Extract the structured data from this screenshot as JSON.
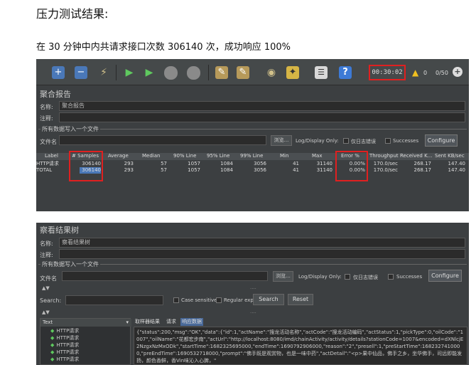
{
  "doc": {
    "title": "压力测试结果:",
    "summary": "在 30 分钟中内共请求接口次数 306140 次，成功响应 100%"
  },
  "aggregate": {
    "timer": "00:30:02",
    "warn_count": "0",
    "threads": "0/50",
    "panel_title": "聚合报告",
    "name_label": "名称:",
    "name_value": "聚合报告",
    "comment_label": "注释:",
    "group_title": "所有数据写入一个文件",
    "file_label": "文件名",
    "browse_label": "浏览...",
    "log_display": "Log/Display Only:",
    "errors_only": "仅日志错误",
    "successes": "Successes",
    "configure": "Configure",
    "columns": [
      "Label",
      "# Samples",
      "Average",
      "Median",
      "90% Line",
      "95% Line",
      "99% Line",
      "Min",
      "Max",
      "Error %",
      "Throughput",
      "Received K...",
      "Sent KB/sec"
    ],
    "rows": [
      [
        "HTTP请求",
        "306140",
        "293",
        "57",
        "1057",
        "1084",
        "3056",
        "41",
        "31140",
        "0.00%",
        "170.0/sec",
        "268.17",
        "147.40"
      ],
      [
        "TOTAL",
        "306140",
        "293",
        "57",
        "1057",
        "1084",
        "3056",
        "41",
        "31140",
        "0.00%",
        "170.0/sec",
        "268.17",
        "147.40"
      ]
    ]
  },
  "results_tree": {
    "panel_title": "察看结果树",
    "name_label": "名称:",
    "name_value": "察看结果树",
    "comment_label": "注释:",
    "group_title": "所有数据写入一个文件",
    "file_label": "文件名",
    "browse_label": "浏览...",
    "log_display": "Log/Display Only:",
    "errors_only": "仅日志错误",
    "successes": "Successes",
    "configure": "Configure",
    "search_label": "Search:",
    "case_sensitive": "Case sensitive",
    "regular_exp": "Regular exp.",
    "search_button": "Search",
    "reset_button": "Reset",
    "renderer": "Text",
    "tabs": [
      "取样器结果",
      "请求",
      "响应数据"
    ],
    "tree_items": [
      "HTTP请求",
      "HTTP请求",
      "HTTP请求",
      "HTTP请求",
      "HTTP请求"
    ],
    "response_text": "{\"status\":200,\"msg\":\"OK\",\"data\":{\"id\":1,\"actName\":\"搜龙活动名称\",\"actCode\":\"搜龙活动编码\",\"actStatus\":1,\"pickType\":0,\"oilCode\":\"1007\",\"oilName\":\"花都宏步南\",\"actUrl\":\"http://localhost:8080/imd/chainActivity/activity/details?stationCode=1007&encoded=dXNlcjE2NzgxNzMxODk\",\"startTime\":1682325695000,\"endTime\":1690792906000,\"reason\":\"2\",\"presell\":1,\"preStartTime\":1682327410000,\"preEndTime\":1690532718000,\"prompt\":\"佛手既是观赏物，也是一味中药\",\"actDetail\":\"<p>果中仙品，佛手之乡，坐华佛手，司远即能发扬，颜色香鲜，香Vin味沁入心脾，\""
  }
}
